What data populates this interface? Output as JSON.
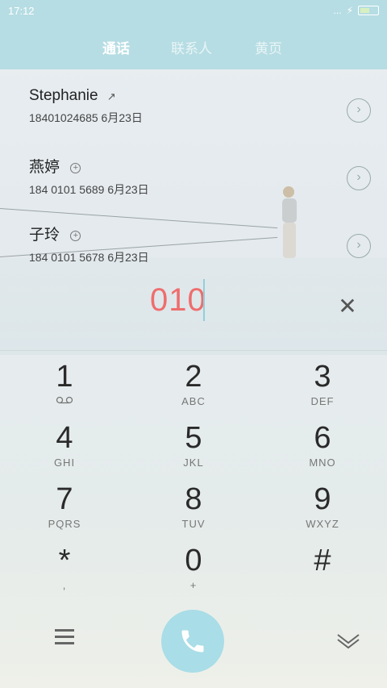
{
  "status_bar": {
    "time": "17:12",
    "signal_text": "..."
  },
  "tabs": [
    {
      "label": "通话",
      "active": true
    },
    {
      "label": "联系人",
      "active": false
    },
    {
      "label": "黄页",
      "active": false
    }
  ],
  "contacts": [
    {
      "name": "Stephanie",
      "number": "18401024685",
      "date": "6月23日",
      "icon": "outgoing-call-icon"
    },
    {
      "name": "燕婷",
      "number": "184 0101 5689",
      "date": "6月23日",
      "icon": "add-contact-icon"
    },
    {
      "name": "子玲",
      "number": "184 0101 5678",
      "date": "6月23日",
      "icon": "add-contact-icon"
    }
  ],
  "dialer": {
    "input": "010"
  },
  "keypad": [
    {
      "digit": "1",
      "letters": "voicemail-icon"
    },
    {
      "digit": "2",
      "letters": "ABC"
    },
    {
      "digit": "3",
      "letters": "DEF"
    },
    {
      "digit": "4",
      "letters": "GHI"
    },
    {
      "digit": "5",
      "letters": "JKL"
    },
    {
      "digit": "6",
      "letters": "MNO"
    },
    {
      "digit": "7",
      "letters": "PQRS"
    },
    {
      "digit": "8",
      "letters": "TUV"
    },
    {
      "digit": "9",
      "letters": "WXYZ"
    },
    {
      "digit": "*",
      "letters": ","
    },
    {
      "digit": "0",
      "letters": "+"
    },
    {
      "digit": "#",
      "letters": ""
    }
  ],
  "colors": {
    "accent": "#b6dde3",
    "dial_text": "#ef6d6d",
    "call_button": "#a9dde7"
  }
}
